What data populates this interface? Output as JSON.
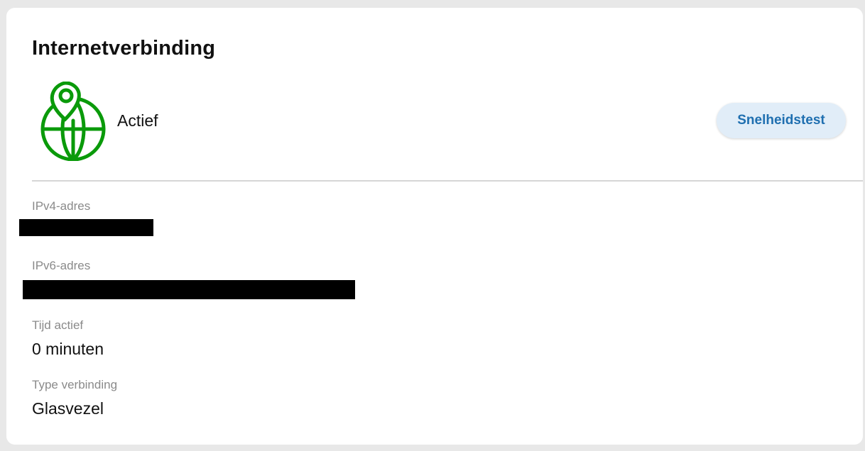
{
  "card": {
    "title": "Internetverbinding",
    "status_icon": "globe-location-pin-icon",
    "status": "Actief",
    "speedtest_label": "Snelheidstest",
    "accent_color": "#0a9a0a",
    "button_text_color": "#1f6fb0"
  },
  "fields": {
    "ipv4": {
      "label": "IPv4-adres",
      "value": "[redacted]"
    },
    "ipv6": {
      "label": "IPv6-adres",
      "value": "[redacted]"
    },
    "uptime": {
      "label": "Tijd actief",
      "value": "0 minuten"
    },
    "connection_type": {
      "label": "Type verbinding",
      "value": "Glasvezel"
    }
  }
}
